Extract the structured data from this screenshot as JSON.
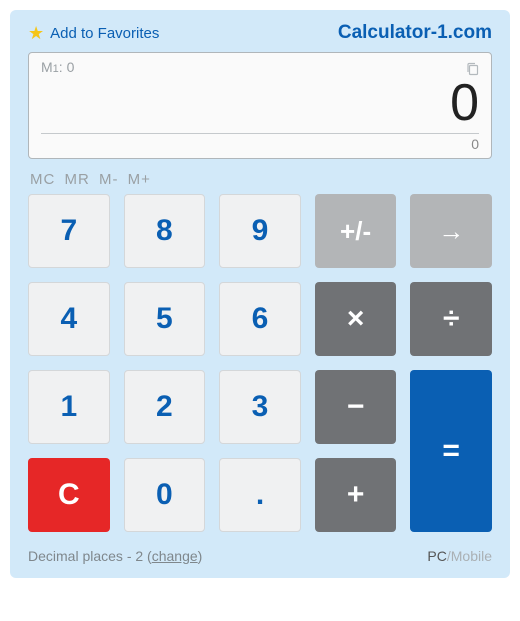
{
  "header": {
    "favorites_label": "Add to Favorites",
    "brand": "Calculator-1.com"
  },
  "display": {
    "memory_label": "M",
    "memory_value": "0",
    "main": "0",
    "sub": "0"
  },
  "memory_buttons": {
    "mc": "MC",
    "mr": "MR",
    "mminus": "M-",
    "mplus": "M+"
  },
  "keypad": {
    "seven": "7",
    "eight": "8",
    "nine": "9",
    "sign": "+/-",
    "arrow": "→",
    "four": "4",
    "five": "5",
    "six": "6",
    "multiply": "×",
    "divide": "÷",
    "one": "1",
    "two": "2",
    "three": "3",
    "minus": "−",
    "equals": "=",
    "clear": "C",
    "zero": "0",
    "dot": ".",
    "plus": "+"
  },
  "footer": {
    "decimal_label": "Decimal places - 2",
    "change_label": "change",
    "mode_pc": "PC",
    "mode_sep": "/",
    "mode_mobile": "Mobile"
  }
}
